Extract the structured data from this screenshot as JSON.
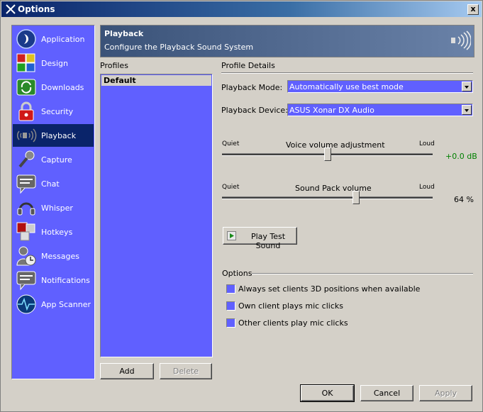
{
  "window": {
    "title": "Options",
    "close_label": "x"
  },
  "sidebar": {
    "items": [
      {
        "label": "Application",
        "icon": "application-icon"
      },
      {
        "label": "Design",
        "icon": "design-icon"
      },
      {
        "label": "Downloads",
        "icon": "downloads-icon"
      },
      {
        "label": "Security",
        "icon": "lock-icon"
      },
      {
        "label": "Playback",
        "icon": "speaker-icon",
        "selected": true
      },
      {
        "label": "Capture",
        "icon": "microphone-icon"
      },
      {
        "label": "Chat",
        "icon": "chat-icon"
      },
      {
        "label": "Whisper",
        "icon": "headset-icon"
      },
      {
        "label": "Hotkeys",
        "icon": "hotkeys-icon"
      },
      {
        "label": "Messages",
        "icon": "messages-icon"
      },
      {
        "label": "Notifications",
        "icon": "notifications-icon"
      },
      {
        "label": "App Scanner",
        "icon": "scanner-icon"
      }
    ]
  },
  "header": {
    "title": "Playback",
    "subtitle": "Configure the Playback Sound System"
  },
  "profiles": {
    "heading": "Profiles",
    "items": [
      "Default"
    ],
    "add_label": "Add",
    "delete_label": "Delete"
  },
  "details": {
    "heading": "Profile Details",
    "mode_label": "Playback Mode:",
    "mode_value": "Automatically use best mode",
    "device_label": "Playback Device:",
    "device_value": "ASUS Xonar DX Audio",
    "voice": {
      "title": "Voice volume adjustment",
      "quiet": "Quiet",
      "loud": "Loud",
      "value": "+0.0 dB",
      "position": 0.5
    },
    "soundpack": {
      "title": "Sound Pack volume",
      "quiet": "Quiet",
      "loud": "Loud",
      "value": "64 %",
      "position": 0.64
    },
    "play_label": "Play Test Sound"
  },
  "options": {
    "heading": "Options",
    "items": [
      "Always set clients 3D positions when available",
      "Own client plays mic clicks",
      "Other clients play mic clicks"
    ]
  },
  "footer": {
    "ok": "OK",
    "cancel": "Cancel",
    "apply": "Apply"
  },
  "colors": {
    "accent": "#6060ff",
    "selected": "#0a246a",
    "positive": "#008000"
  }
}
